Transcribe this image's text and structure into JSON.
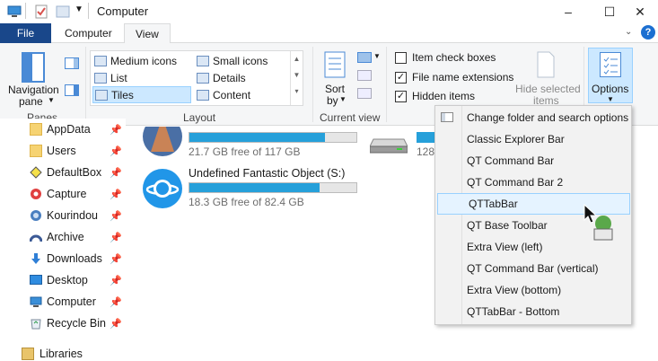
{
  "window": {
    "title": "Computer",
    "controls": {
      "minimize": "–",
      "maximize": "☐",
      "close": "✕"
    }
  },
  "tabs": {
    "file": "File",
    "computer": "Computer",
    "view": "View"
  },
  "ribbon": {
    "panes": {
      "navigation_pane_line1": "Navigation",
      "navigation_pane_line2": "pane",
      "group_label": "Panes"
    },
    "layout": {
      "items": [
        "Medium icons",
        "Small icons",
        "List",
        "Details",
        "Tiles",
        "Content"
      ],
      "selected": "Tiles",
      "group_label": "Layout"
    },
    "current_view": {
      "sort_by_line1": "Sort",
      "sort_by_line2": "by",
      "group_label": "Current view"
    },
    "show_hide": {
      "item_check_boxes": "Item check boxes",
      "file_name_extensions": "File name extensions",
      "hidden_items": "Hidden items",
      "hide_selected_line1": "Hide selected",
      "hide_selected_line2": "items",
      "states": {
        "item_check_boxes": false,
        "file_name_extensions": true,
        "hidden_items": true
      }
    },
    "options": {
      "label": "Options"
    }
  },
  "nav": {
    "items": [
      {
        "label": "AppData",
        "icon": "folder-icon"
      },
      {
        "label": "Users",
        "icon": "folder-icon"
      },
      {
        "label": "DefaultBox",
        "icon": "sandbox-icon"
      },
      {
        "label": "Capture",
        "icon": "capture-icon"
      },
      {
        "label": "Kourindou",
        "icon": "kourindou-icon"
      },
      {
        "label": "Archive",
        "icon": "archive-icon"
      },
      {
        "label": "Downloads",
        "icon": "downloads-icon"
      },
      {
        "label": "Desktop",
        "icon": "desktop-icon"
      },
      {
        "label": "Computer",
        "icon": "computer-icon"
      },
      {
        "label": "Recycle Bin",
        "icon": "recycle-bin-icon"
      }
    ],
    "libraries": "Libraries"
  },
  "drives": [
    {
      "free_text": "21.7 GB free of 117 GB",
      "used_fraction": 0.81
    },
    {
      "name": "Undefined Fantastic Object (S:)",
      "free_text": "18.3 GB free of 82.4 GB",
      "used_fraction": 0.78
    },
    {
      "partial_text": "128"
    }
  ],
  "menu": {
    "items": [
      "Change folder and search options",
      "Classic Explorer Bar",
      "QT Command Bar",
      "QT Command Bar 2",
      "QTTabBar",
      "QT Base Toolbar",
      "Extra View (left)",
      "QT Command Bar (vertical)",
      "Extra View (bottom)",
      "QTTabBar - Bottom"
    ],
    "highlighted": "QTTabBar"
  },
  "colors": {
    "file_tab": "#19478a",
    "accent": "#26a0da",
    "highlight": "#cce8ff"
  }
}
